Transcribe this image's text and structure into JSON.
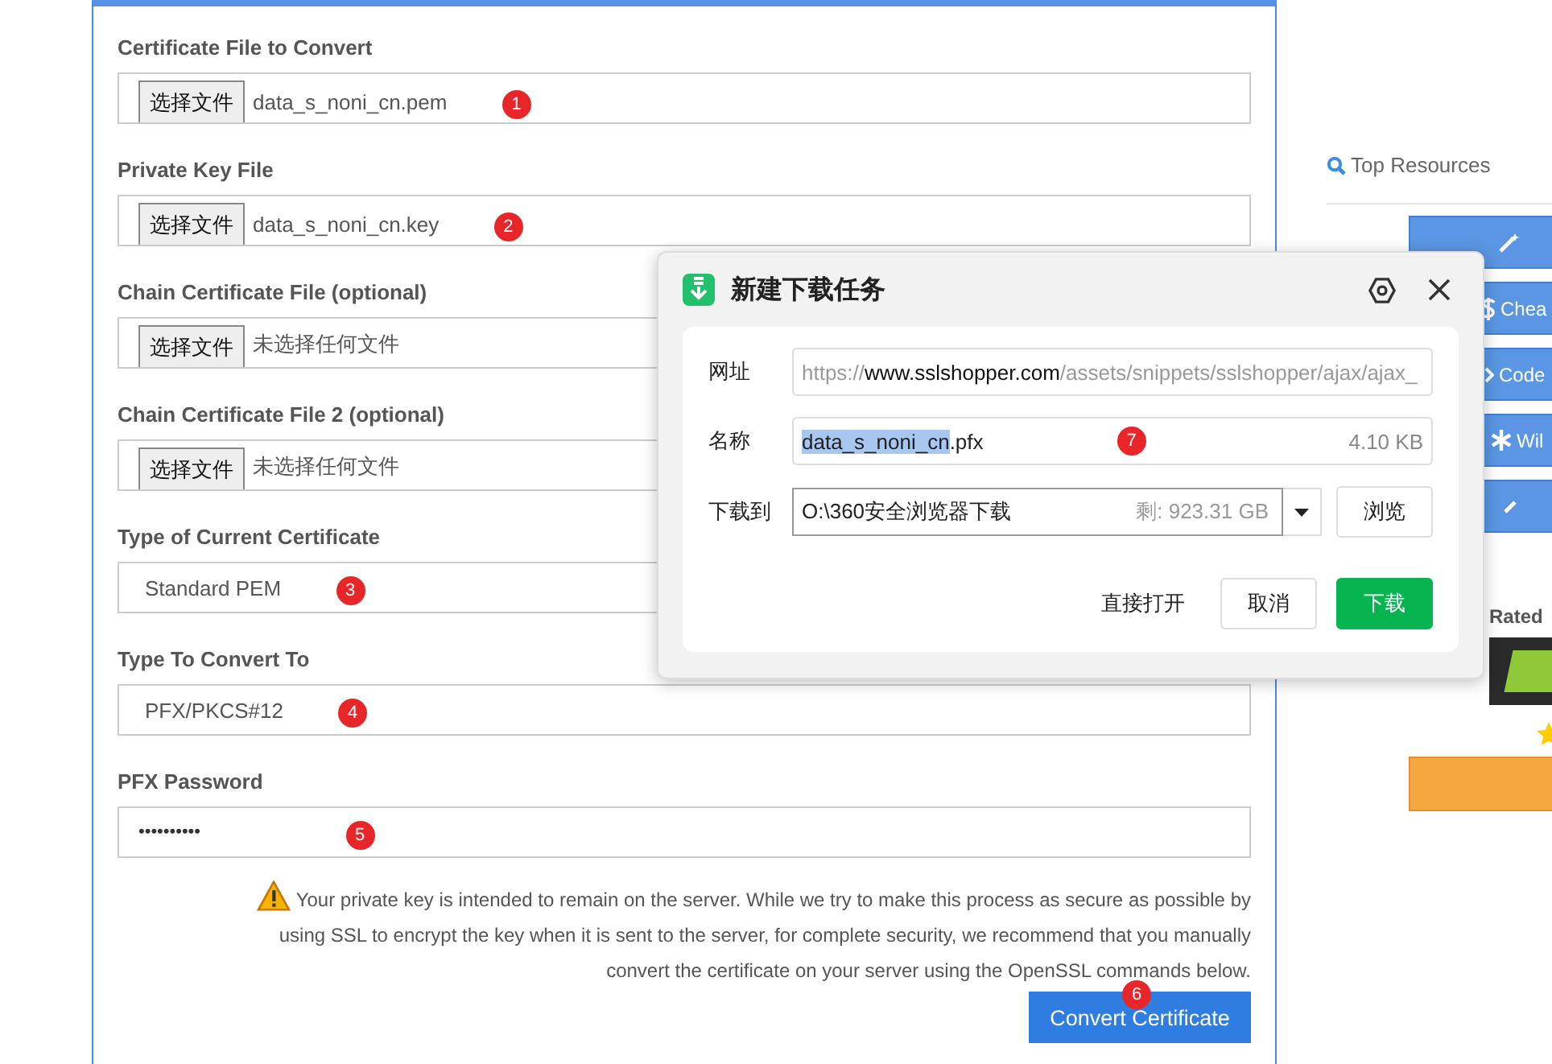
{
  "form": {
    "file_fields": [
      {
        "label": "Certificate File to Convert",
        "button": "选择文件",
        "value": "data_s_noni_cn.pem",
        "marker": "1"
      },
      {
        "label": "Private Key File",
        "button": "选择文件",
        "value": "data_s_noni_cn.key",
        "marker": "2"
      },
      {
        "label": "Chain Certificate File (optional)",
        "button": "选择文件",
        "value": "未选择任何文件"
      },
      {
        "label": "Chain Certificate File 2 (optional)",
        "button": "选择文件",
        "value": "未选择任何文件"
      }
    ],
    "select_fields": [
      {
        "label": "Type of Current Certificate",
        "value": "Standard PEM",
        "marker": "3"
      },
      {
        "label": "Type To Convert To",
        "value": "PFX/PKCS#12",
        "marker": "4"
      }
    ],
    "password": {
      "label": "PFX Password",
      "value": "••••••••••",
      "marker": "5"
    },
    "notice": "Your private key is intended to remain on the server. While we try to make this process as secure as possible by using SSL to encrypt the key when it is sent to the server, for complete security, we recommend that you manually convert the certificate on your server using the OpenSSL commands below.",
    "submit": {
      "label": "Convert Certificate",
      "marker": "6"
    }
  },
  "sidebar": {
    "heading": "Top Resources",
    "buttons": [
      {
        "kind": "wand"
      },
      {
        "kind": "dollar",
        "label": "Chea"
      },
      {
        "kind": "code",
        "label": "Code"
      },
      {
        "kind": "asterisk",
        "label": "Wil"
      },
      {
        "kind": "partial"
      }
    ],
    "rated": "Rated"
  },
  "download_dialog": {
    "title": "新建下载任务",
    "url": {
      "label": "网址",
      "scheme": "https://",
      "host": "www.sslshopper.com",
      "path": "/assets/snippets/sslshopper/ajax/ajax_"
    },
    "name": {
      "label": "名称",
      "selected_part": "data_s_noni_cn",
      "rest": ".pfx",
      "size": "4.10 KB",
      "marker": "7"
    },
    "save_to": {
      "label": "下载到",
      "path": "O:\\360安全浏览器下载",
      "free": "剩: 923.31 GB",
      "browse": "浏览"
    },
    "actions": {
      "open": "直接打开",
      "cancel": "取消",
      "download": "下载"
    }
  }
}
